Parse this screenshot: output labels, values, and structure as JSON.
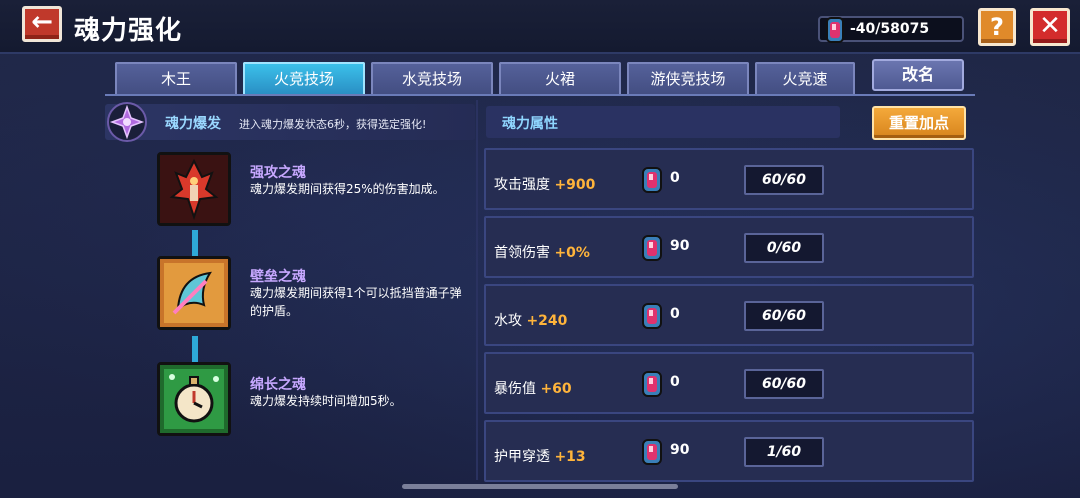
{
  "header": {
    "back_glyph": "←",
    "title": "魂力强化",
    "currency_value": "-40/58075",
    "help_glyph": "?",
    "close_glyph": "✕"
  },
  "tabs": [
    {
      "label": "木王",
      "active": false
    },
    {
      "label": "火竞技场",
      "active": true
    },
    {
      "label": "水竞技场",
      "active": false
    },
    {
      "label": "火裙",
      "active": false
    },
    {
      "label": "游侠竞技场",
      "active": false
    },
    {
      "label": "火竞速",
      "active": false
    }
  ],
  "rename_label": "改名",
  "burst": {
    "title": "魂力爆发",
    "description": "进入魂力爆发状态6秒，获得选定强化!"
  },
  "souls": [
    {
      "name": "强攻之魂",
      "description": "魂力爆发期间获得25%的伤害加成。",
      "icon": "red-sword-icon"
    },
    {
      "name": "壁垒之魂",
      "description": "魂力爆发期间获得1个可以抵挡普通子弹的护盾。",
      "icon": "shield-icon"
    },
    {
      "name": "绵长之魂",
      "description": "魂力爆发持续时间增加5秒。",
      "icon": "stopwatch-icon"
    }
  ],
  "attributes_header": "魂力属性",
  "reset_label": "重置加点",
  "attributes": [
    {
      "name": "攻击强度",
      "bonus": "+900",
      "cost": "0",
      "progress": "60/60"
    },
    {
      "name": "首领伤害",
      "bonus": "+0%",
      "cost": "90",
      "progress": "0/60"
    },
    {
      "name": "水攻",
      "bonus": "+240",
      "cost": "0",
      "progress": "60/60"
    },
    {
      "name": "暴伤值",
      "bonus": "+60",
      "cost": "0",
      "progress": "60/60"
    },
    {
      "name": "护甲穿透",
      "bonus": "+13",
      "cost": "90",
      "progress": "1/60"
    }
  ],
  "colors": {
    "active_tab": "#3bc0ea",
    "bonus": "#ffb43b",
    "soul_name": "#c7a8ff"
  }
}
